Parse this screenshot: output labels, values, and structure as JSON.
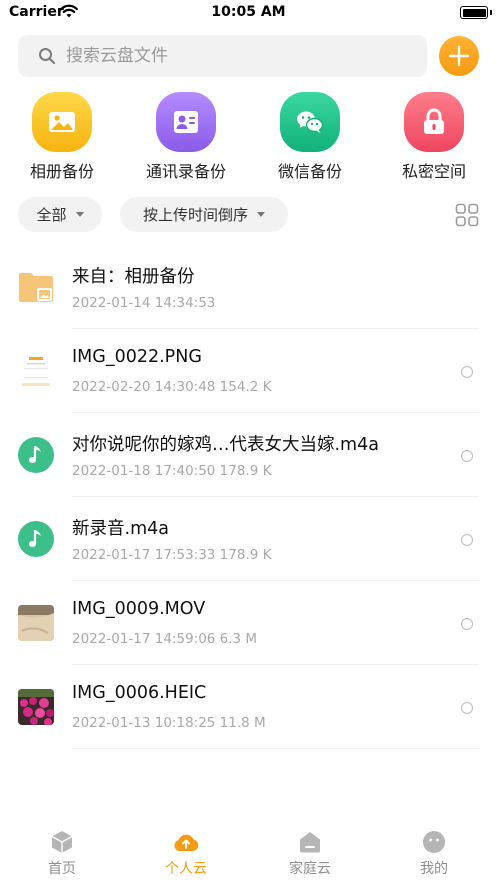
{
  "status_bar": {
    "carrier": "Carrier",
    "time": "10:05 AM"
  },
  "search": {
    "placeholder": "搜索云盘文件"
  },
  "quick_entries": [
    {
      "label": "相册备份",
      "icon": "photo-album-icon",
      "color": "#f9c21a"
    },
    {
      "label": "通讯录备份",
      "icon": "contacts-icon",
      "color": "#9b6cf3"
    },
    {
      "label": "微信备份",
      "icon": "wechat-icon",
      "color": "#1ec38a"
    },
    {
      "label": "私密空间",
      "icon": "lock-icon",
      "color": "#f2566b"
    }
  ],
  "filters": {
    "type": "全部",
    "sort": "按上传时间倒序"
  },
  "files": [
    {
      "name": "来自：相册备份",
      "meta": "2022-01-14 14:34:53",
      "kind": "folder"
    },
    {
      "name": "IMG_0022.PNG",
      "meta": "2022-02-20 14:30:48  154.2 K",
      "kind": "screenshot"
    },
    {
      "name": "对你说呢你的嫁鸡…代表女大当嫁.m4a",
      "meta": "2022-01-18 17:40:50  178.9 K",
      "kind": "audio"
    },
    {
      "name": "新录音.m4a",
      "meta": "2022-01-17 17:53:33  178.9 K",
      "kind": "audio"
    },
    {
      "name": "IMG_0009.MOV",
      "meta": "2022-01-17 14:59:06  6.3 M",
      "kind": "video"
    },
    {
      "name": "IMG_0006.HEIC",
      "meta": "2022-01-13 10:18:25  11.8 M",
      "kind": "photo"
    }
  ],
  "tabs": [
    {
      "label": "首页",
      "icon": "cube-icon",
      "active": false
    },
    {
      "label": "个人云",
      "icon": "cloud-upload-icon",
      "active": true
    },
    {
      "label": "家庭云",
      "icon": "house-icon",
      "active": false
    },
    {
      "label": "我的",
      "icon": "face-icon",
      "active": false
    }
  ],
  "colors": {
    "accent": "#f59a12",
    "audio": "#3cbf8a",
    "folder": "#f8c47a"
  }
}
